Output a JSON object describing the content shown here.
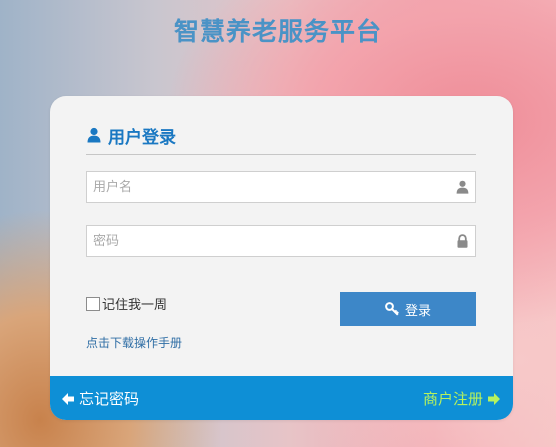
{
  "platform_title": "智慧养老服务平台",
  "login": {
    "title": "用户登录",
    "username_placeholder": "用户名",
    "password_placeholder": "密码",
    "remember_label": "记住我一周",
    "submit_label": "登录",
    "manual_link": "点击下载操作手册"
  },
  "footer": {
    "forgot_password": "忘记密码",
    "merchant_register": "商户注册"
  },
  "colors": {
    "title": "#4a93c6",
    "accent": "#1a78c2",
    "button": "#3d87c8",
    "bar": "#0e8fd6",
    "register": "#b6f25e"
  },
  "icons": {
    "title_icon": "user-icon",
    "username_icon": "user-icon",
    "password_icon": "lock-icon",
    "submit_icon": "key-icon",
    "forgot_icon": "arrow-left-icon",
    "register_icon": "arrow-right-icon"
  }
}
